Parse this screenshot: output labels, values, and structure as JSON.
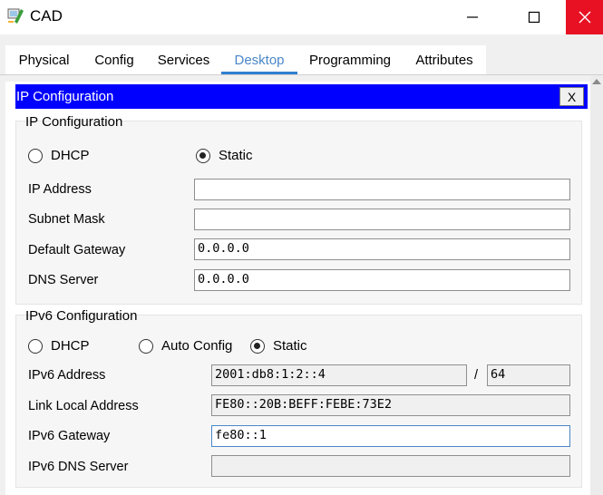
{
  "window": {
    "title": "CAD",
    "controls": {
      "minimize": "—",
      "maximize": "☐",
      "close": "✕"
    }
  },
  "tabs": [
    {
      "label": "Physical",
      "active": false
    },
    {
      "label": "Config",
      "active": false
    },
    {
      "label": "Services",
      "active": false
    },
    {
      "label": "Desktop",
      "active": true
    },
    {
      "label": "Programming",
      "active": false
    },
    {
      "label": "Attributes",
      "active": false
    }
  ],
  "panel": {
    "title": "IP Configuration",
    "close_label": "X"
  },
  "ipv4": {
    "title": "IP Configuration",
    "mode_options": [
      {
        "label": "DHCP",
        "selected": false
      },
      {
        "label": "Static",
        "selected": true
      }
    ],
    "fields": [
      {
        "label": "IP Address",
        "value": ""
      },
      {
        "label": "Subnet Mask",
        "value": ""
      },
      {
        "label": "Default Gateway",
        "value": "0.0.0.0"
      },
      {
        "label": "DNS Server",
        "value": "0.0.0.0"
      }
    ]
  },
  "ipv6": {
    "title": "IPv6 Configuration",
    "mode_options": [
      {
        "label": "DHCP",
        "selected": false
      },
      {
        "label": "Auto Config",
        "selected": false
      },
      {
        "label": "Static",
        "selected": true
      }
    ],
    "address": {
      "label": "IPv6 Address",
      "value": "2001:db8:1:2::4",
      "separator": "/",
      "prefix": "64"
    },
    "link_local": {
      "label": "Link Local Address",
      "value": "FE80::20B:BEFF:FEBE:73E2"
    },
    "gateway": {
      "label": "IPv6 Gateway",
      "value": "fe80::1"
    },
    "dns": {
      "label": "IPv6 DNS Server",
      "value": ""
    }
  },
  "colors": {
    "header_bg": "#0000ff",
    "close_bg": "#e81123",
    "active_tab": "#2f7fd0"
  }
}
